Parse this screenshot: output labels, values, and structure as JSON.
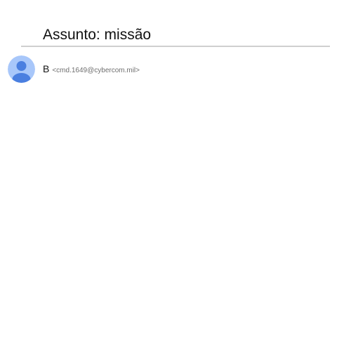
{
  "email": {
    "subject": "Assunto: missão",
    "sender": {
      "name": "B",
      "email": "<cmd.1649@cybercom.mil>",
      "avatar_icon": "default-person-icon"
    }
  },
  "colors": {
    "avatar_background": "#a8c7fa",
    "avatar_figure": "#4a7fe0",
    "divider": "#cfcfcf",
    "email_text": "#6f6f6f"
  }
}
